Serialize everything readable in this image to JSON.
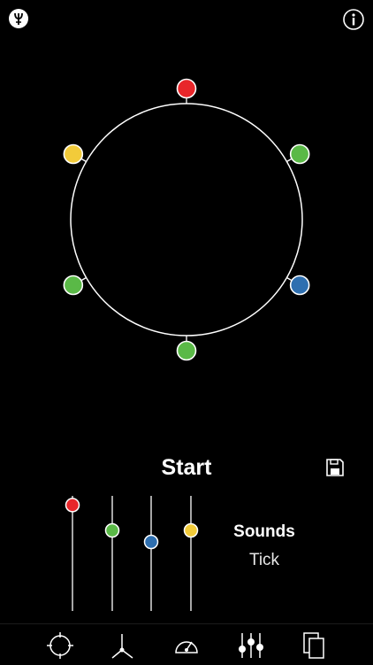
{
  "header": {
    "left_icon": "metronome-icon",
    "right_icon": "info-icon"
  },
  "beat_circle": {
    "beats": [
      {
        "color": "#e8262a"
      },
      {
        "color": "#5ab947"
      },
      {
        "color": "#2e6fb0"
      },
      {
        "color": "#5ab947"
      },
      {
        "color": "#5ab947"
      },
      {
        "color": "#f2cb3a"
      }
    ]
  },
  "controls": {
    "start_label": "Start",
    "save_icon": "floppy-disk-icon"
  },
  "mixer": {
    "sliders": [
      {
        "color": "#e8262a",
        "level": 0.92
      },
      {
        "color": "#5ab947",
        "level": 0.7
      },
      {
        "color": "#2e6fb0",
        "level": 0.6
      },
      {
        "color": "#f2cb3a",
        "level": 0.7
      }
    ]
  },
  "sounds": {
    "title": "Sounds",
    "value": "Tick"
  },
  "tabbar": {
    "tabs": [
      {
        "icon": "crosshair-icon"
      },
      {
        "icon": "metronome-arm-icon"
      },
      {
        "icon": "speedometer-icon"
      },
      {
        "icon": "mixer-sliders-icon"
      },
      {
        "icon": "copy-pages-icon"
      }
    ]
  }
}
